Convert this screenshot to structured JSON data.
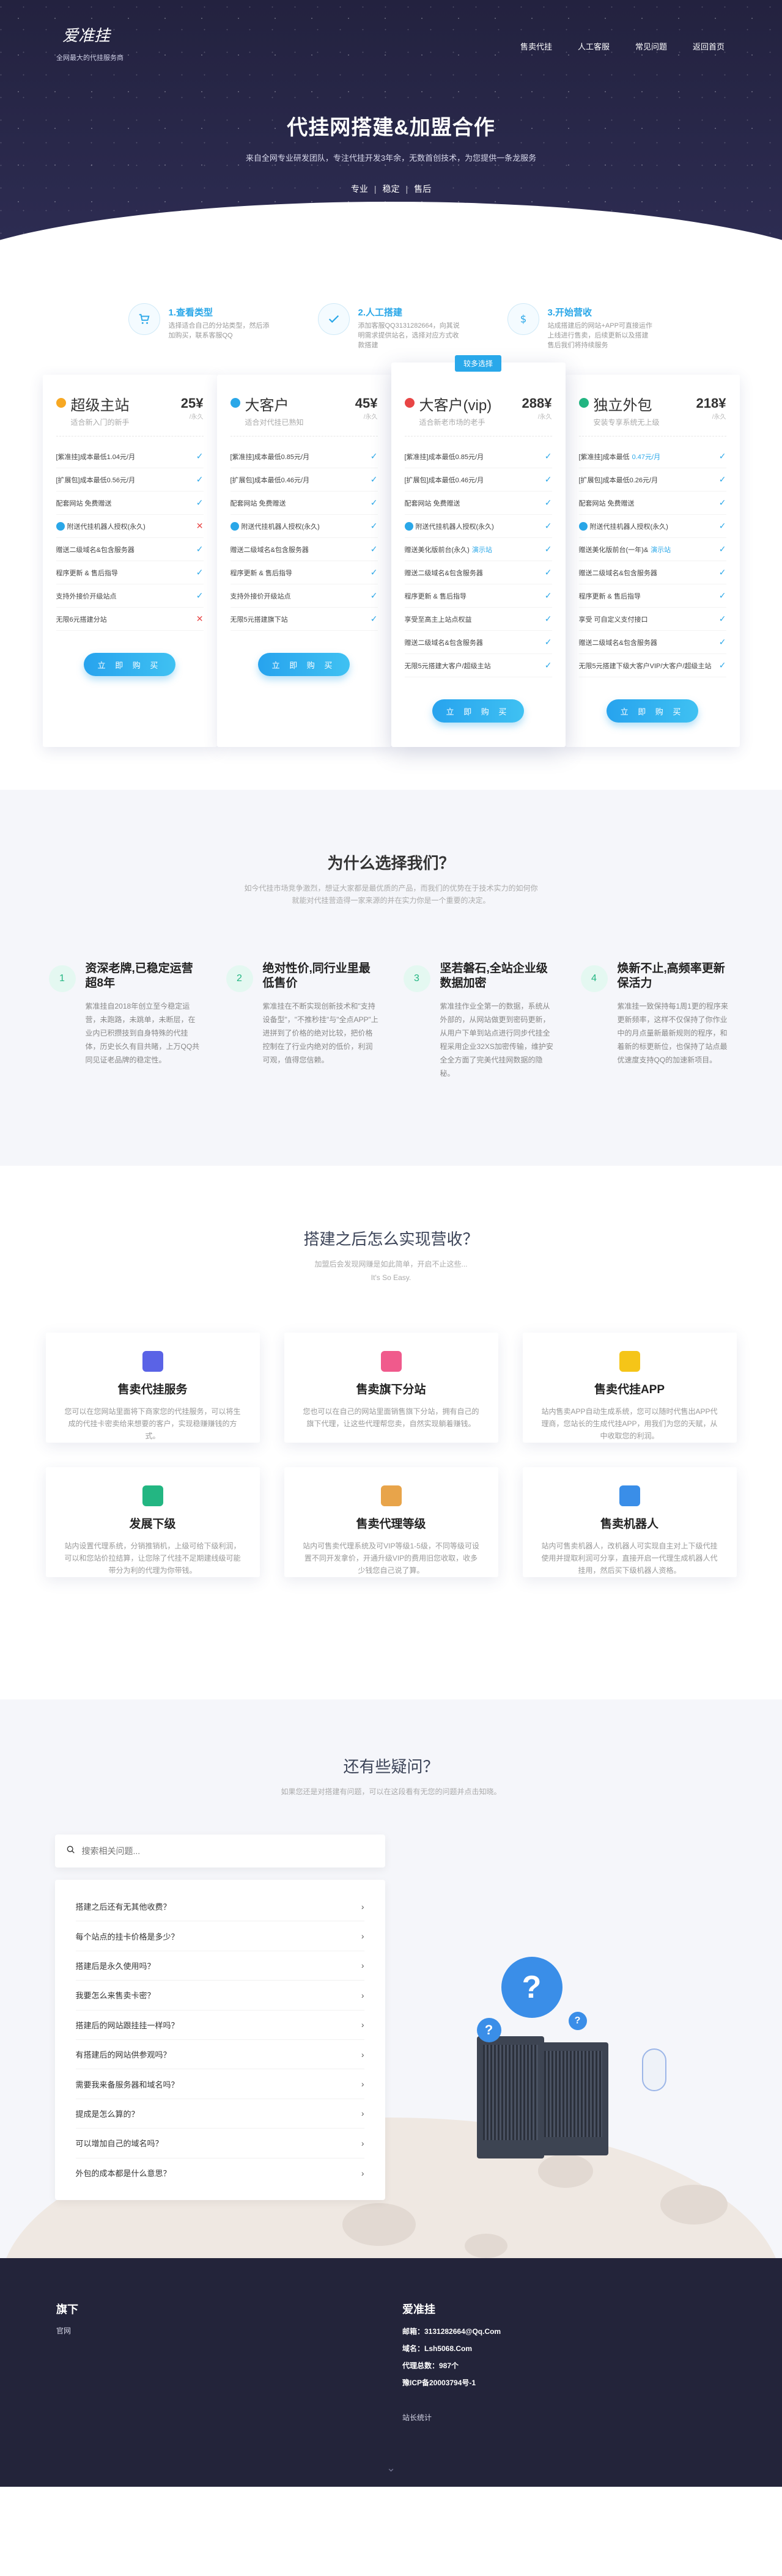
{
  "header": {
    "logo_text": "爱准挂",
    "logo_sub": "全网最大的代挂服务商",
    "nav": [
      "售卖代挂",
      "人工客服",
      "常见问题",
      "返回首页"
    ]
  },
  "hero": {
    "title": "代挂网搭建&加盟合作",
    "subtitle": "来自全网专业研发团队，专注代挂开发3年余，无数首创技术，为您提供一条龙服务",
    "tags": [
      "专业",
      "稳定",
      "售后"
    ]
  },
  "steps": [
    {
      "title": "1.查看类型",
      "desc": "选择适合自己的分站类型，然后添加购买，联系客服QQ"
    },
    {
      "title": "2.人工搭建",
      "desc": "添加客服QQ3131282664，向其说明需求提供站名，选择对应方式收款搭建"
    },
    {
      "title": "3.开始营收",
      "desc": "站成搭建后的网站+APP可直接运作上线进行售卖，后续更新以及搭建售后我们将持续服务"
    }
  ],
  "pricing": {
    "badge": "较多选择",
    "buy_label": "立 即 购 买",
    "plans": [
      {
        "name": "超级主站",
        "caption": "适合新入门的新手",
        "price": "25¥",
        "unit": "/永久",
        "icon_color": "#f7a823",
        "features": [
          {
            "text": "[紫准挂]成本最低1.04元/月",
            "ok": true
          },
          {
            "text": "[扩展包]成本最低0.56元/月",
            "ok": true
          },
          {
            "text": "配套网站 免费赠送",
            "ok": true
          },
          {
            "text": "附送代挂机器人授权(永久)",
            "ok": false,
            "dot": true
          },
          {
            "text": "赠送二级域名&包含服务器",
            "ok": true
          },
          {
            "text": "程序更新 & 售后指导",
            "ok": true
          },
          {
            "text": "支持外接价开级站点",
            "ok": true
          },
          {
            "text": "无限6元搭建分站",
            "ok": false
          }
        ]
      },
      {
        "name": "大客户",
        "caption": "适合对代挂已熟知",
        "price": "45¥",
        "unit": "/永久",
        "icon_color": "#2aa7e8",
        "features": [
          {
            "text": "[紫准挂]成本最低0.85元/月",
            "ok": true
          },
          {
            "text": "[扩展包]成本最低0.46元/月",
            "ok": true
          },
          {
            "text": "配套网站 免费赠送",
            "ok": true
          },
          {
            "text": "附送代挂机器人授权(永久)",
            "ok": true,
            "dot": true
          },
          {
            "text": "赠送二级域名&包含服务器",
            "ok": true
          },
          {
            "text": "程序更新 & 售后指导",
            "ok": true
          },
          {
            "text": "支持外接价开级站点",
            "ok": true
          },
          {
            "text": "无限5元搭建旗下站",
            "ok": true
          }
        ]
      },
      {
        "name": "大客户(vip)",
        "caption": "适合新老市场的老手",
        "price": "288¥",
        "unit": "/永久",
        "icon_color": "#e84545",
        "features": [
          {
            "text": "[紫准挂]成本最低0.85元/月",
            "ok": true
          },
          {
            "text": "[扩展包]成本最低0.46元/月",
            "ok": true
          },
          {
            "text": "配套网站 免费赠送",
            "ok": true
          },
          {
            "text": "附送代挂机器人授权(永久)",
            "ok": true,
            "dot": true
          },
          {
            "text": "赠送美化版前台(永久)",
            "hl": "演示站",
            "ok": true
          },
          {
            "text": "赠送二级域名&包含服务器",
            "ok": true
          },
          {
            "text": "程序更新 & 售后指导",
            "ok": true
          },
          {
            "text": "享受至高主上站点权益",
            "ok": true
          },
          {
            "text": "赠送二级域名&包含服务器",
            "ok": true
          },
          {
            "text": "无限5元搭建大客户/超级主站",
            "ok": true
          }
        ]
      },
      {
        "name": "独立外包",
        "caption": "安装专享系统无上级",
        "price": "218¥",
        "unit": "/永久",
        "icon_color": "#23b682",
        "features": [
          {
            "text": "[紫准挂]成本最低",
            "hl": "0.47元/月",
            "ok": true
          },
          {
            "text": "[扩展包]成本最低0.26元/月",
            "ok": true
          },
          {
            "text": "配套网站 免费赠送",
            "ok": true
          },
          {
            "text": "附送代挂机器人授权(永久)",
            "ok": true,
            "dot": true
          },
          {
            "text": "赠送美化版前台(一年)&",
            "hl": "演示站",
            "ok": true
          },
          {
            "text": "赠送二级域名&包含服务器",
            "ok": true
          },
          {
            "text": "程序更新 & 售后指导",
            "ok": true
          },
          {
            "text": "享受 可自定义支付接口",
            "ok": true
          },
          {
            "text": "赠送二级域名&包含服务器",
            "ok": true
          },
          {
            "text": "无限5元搭建下级大客户VIP/大客户/超级主站",
            "ok": true
          }
        ]
      }
    ]
  },
  "why": {
    "title": "为什么选择我们？",
    "subtitle": "如今代挂市场竞争激烈，想证大家都是最优质的产品，而我们的优势在于技术实力的如何你就能对代挂营造得一家来源的并在实力你是一个重要的决定。",
    "items": [
      {
        "num": "1",
        "title": "资深老牌,已稳定运营超8年",
        "desc": "紫准挂自2018年创立至今稳定运营，未跑路，未跳单，未断层，在业内已积攒技到自身特殊的代挂体，历史长久有目共睹，上万QQ共同见证老品牌的稳定性。"
      },
      {
        "num": "2",
        "title": "绝对性价,同行业里最低售价",
        "desc": "紫准挂在不断实现创新技术和\"支持设备型\"，\"不推秒挂\"与\"全点APP\"上进拼到了价格的绝对比较，把价格控制在了行业内绝对的低价，利润可观，值得您信赖。"
      },
      {
        "num": "3",
        "title": "坚若磐石,全站企业级数据加密",
        "desc": "紫准挂作业全第一的数据，系统从外部的，从网站做更到密码更新，从用户下单到站点进行同步代挂全程采用企业32XS加密传输，维护安全全方面了完美代挂网数据的隐秘。"
      },
      {
        "num": "4",
        "title": "焕新不止,高频率更新保活力",
        "desc": "紫准挂一致保持每1周1更的程序来更新频率，这样不仅保持了你作业中的月点量新最新规则的程序，和着新的标更新位，也保持了站点最优速度支持QQ的加速新项目。"
      }
    ]
  },
  "profit": {
    "title": "搭建之后怎么实现营收？",
    "subtitle": "加盟后会发现网赚是如此简单，开启不止这些...",
    "subtitle2": "It's So Easy.",
    "cards": [
      {
        "title": "售卖代挂服务",
        "desc": "您可以在您网站里面将下商家您的代挂服务，可以将生成的代挂卡密卖给来想要的客户，实现稳赚赚钱的方式。",
        "color": "#5a63e6",
        "icon": "cart-icon"
      },
      {
        "title": "售卖旗下分站",
        "desc": "您也可以在自己的网站里面销售旗下分站，拥有自己的旗下代理，让这些代理帮您卖，自然实现躺着赚钱。",
        "color": "#f05a8c",
        "icon": "layers-icon"
      },
      {
        "title": "售卖代挂APP",
        "desc": "站内售卖APP自动生成系统，您可以随时代售出APP代理商，您站长的生成代挂APP，用我们为您的天赋，从中收取您的利润。",
        "color": "#f5c518",
        "icon": "cube-icon"
      },
      {
        "title": "发展下级",
        "desc": "站内设置代理系统，分销推销机，上级可给下级利润，可以和您站价拉结算，让您除了代挂不足期建线级可能带分为利的代理为你带钱。",
        "color": "#23b682",
        "icon": "tree-icon"
      },
      {
        "title": "售卖代理等级",
        "desc": "站内可售卖代理系统及可VIP等级1-5级，不同等级可设置不同开发拿价，开通升级VIP的费用旧您收取，收多少钱您自己说了算。",
        "color": "#e8a44a",
        "icon": "badge-icon"
      },
      {
        "title": "售卖机器人",
        "desc": "站内可售卖机器人，改机器人可实现自主对上下级代挂使用并提取利润可分享，直接开启一代理生成机器人代挂用，然后买下级机器人资格。",
        "color": "#3a8ee8",
        "icon": "robot-icon"
      }
    ]
  },
  "faq": {
    "title": "还有些疑问？",
    "subtitle": "如果您还是对搭建有问题，可以在这段看有无您的问题并点击知晓。",
    "search_placeholder": "搜索相关问题...",
    "items": [
      "搭建之后还有无其他收费？",
      "每个站点的挂卡价格是多少？",
      "搭建后是永久使用吗？",
      "我要怎么来售卖卡密？",
      "搭建后的网站跟挂挂一样吗？",
      "有搭建后的网站供参观吗？",
      "需要我来备服务器和域名吗？",
      "提成是怎么算的？",
      "可以增加自己的域名吗？",
      "外包的成本都是什么意思？"
    ]
  },
  "footer": {
    "left_title": "旗下",
    "left_text": "官网",
    "right_title": "爱准挂",
    "lines": [
      "邮箱：3131282664@Qq.Com",
      "域名：Lsh5068.Com",
      "代理总数：987个",
      "豫ICP备20003794号-1"
    ],
    "stats": "站长统计"
  }
}
